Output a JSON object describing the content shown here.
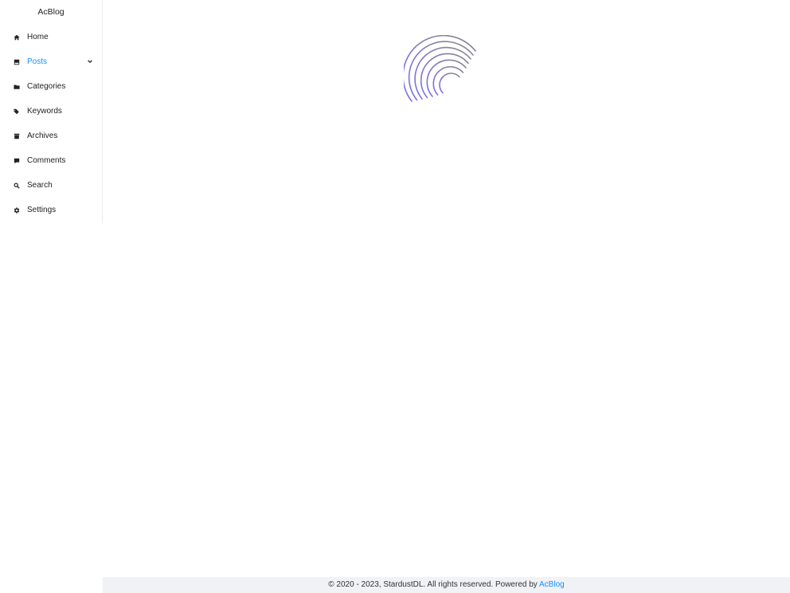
{
  "sidebar": {
    "brand": "AcBlog",
    "items": [
      {
        "label": "Home",
        "icon": "home-icon"
      },
      {
        "label": "Posts",
        "icon": "book-icon",
        "expandable": true,
        "active": true
      },
      {
        "label": "Categories",
        "icon": "folder-icon"
      },
      {
        "label": "Keywords",
        "icon": "tags-icon"
      },
      {
        "label": "Archives",
        "icon": "archive-icon"
      },
      {
        "label": "Comments",
        "icon": "comment-icon"
      },
      {
        "label": "Search",
        "icon": "search-icon"
      },
      {
        "label": "Settings",
        "icon": "gear-icon"
      }
    ]
  },
  "main": {
    "loading": true
  },
  "footer": {
    "text": "© 2020 - 2023, StardustDL. All rights reserved. Powered by",
    "link": "AcBlog"
  },
  "colors": {
    "accent": "#1890ff",
    "footer_bg": "#f0f2f5",
    "spinner_start": "#7c6cf2",
    "spinner_end": "#888888"
  }
}
